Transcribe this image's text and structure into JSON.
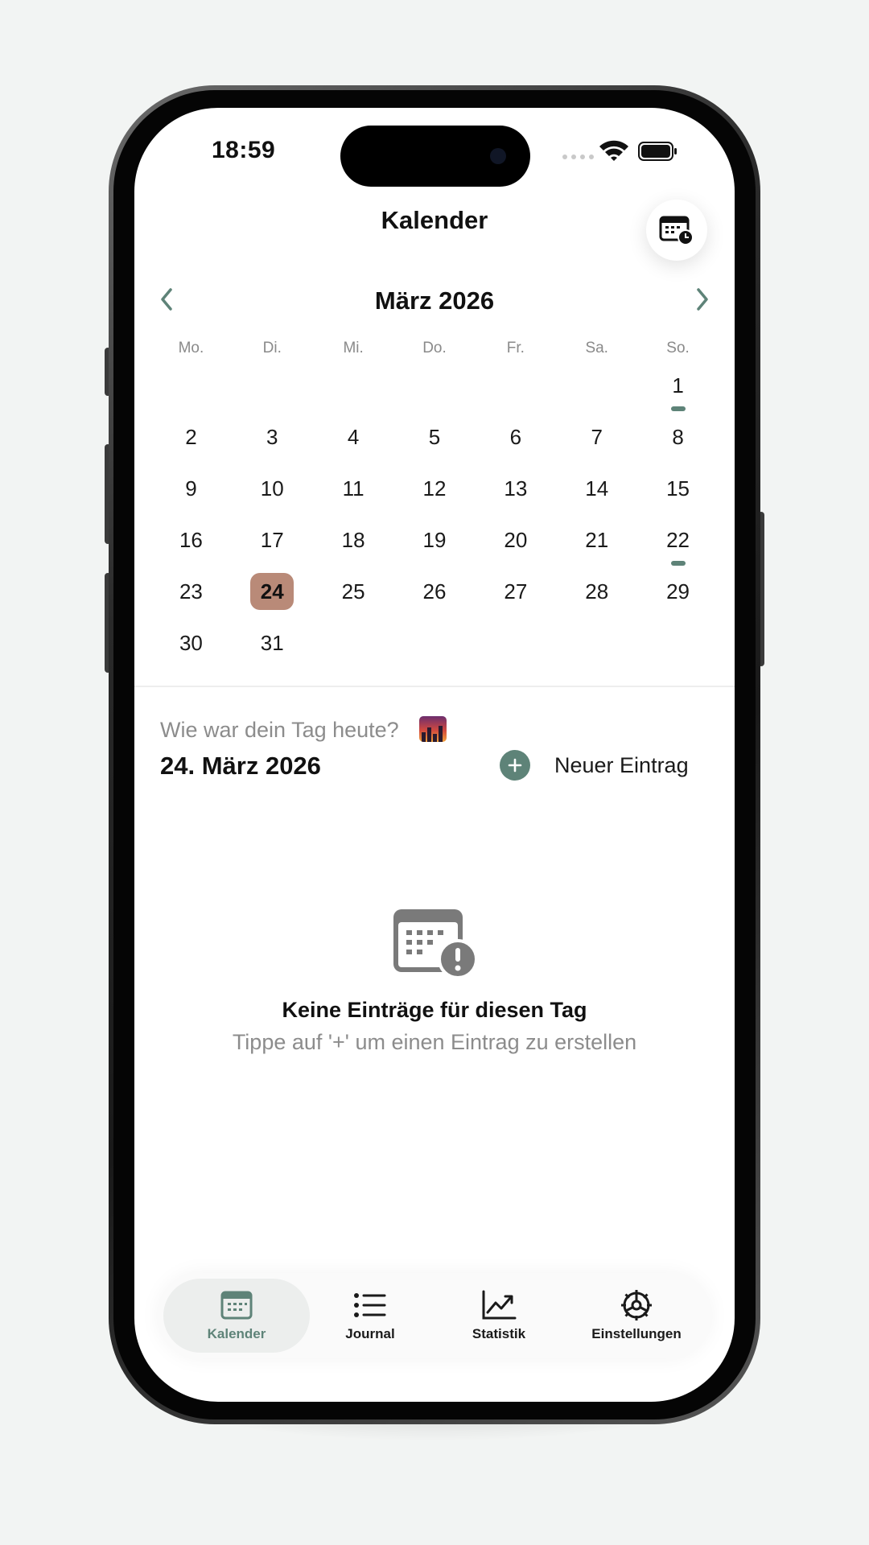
{
  "status_bar": {
    "time": "18:59"
  },
  "header": {
    "title": "Kalender"
  },
  "calendar": {
    "month_title": "März 2026",
    "weekdays": [
      "Mo.",
      "Di.",
      "Mi.",
      "Do.",
      "Fr.",
      "Sa.",
      "So."
    ],
    "rows": [
      [
        null,
        null,
        null,
        null,
        null,
        null,
        1
      ],
      [
        2,
        3,
        4,
        5,
        6,
        7,
        8
      ],
      [
        9,
        10,
        11,
        12,
        13,
        14,
        15
      ],
      [
        16,
        17,
        18,
        19,
        20,
        21,
        22
      ],
      [
        23,
        24,
        25,
        26,
        27,
        28,
        29
      ],
      [
        30,
        31,
        null,
        null,
        null,
        null,
        null
      ]
    ],
    "selected_day": 24,
    "days_with_entries": [
      1,
      22
    ]
  },
  "day_panel": {
    "question": "Wie war dein Tag heute?",
    "date": "24. März 2026",
    "new_entry_label": "Neuer Eintrag"
  },
  "empty_state": {
    "title": "Keine Einträge für diesen Tag",
    "subtitle": "Tippe auf '+' um einen Eintrag zu erstellen"
  },
  "tabs": [
    {
      "label": "Kalender",
      "icon": "calendar-icon",
      "active": true
    },
    {
      "label": "Journal",
      "icon": "list-icon",
      "active": false
    },
    {
      "label": "Statistik",
      "icon": "chart-icon",
      "active": false
    },
    {
      "label": "Einstellungen",
      "icon": "settings-icon",
      "active": false
    }
  ],
  "colors": {
    "accent": "#5e8378",
    "selected_day_bg": "#b98a78",
    "muted_text": "#8c8c8c",
    "background": "#f2f4f3"
  }
}
